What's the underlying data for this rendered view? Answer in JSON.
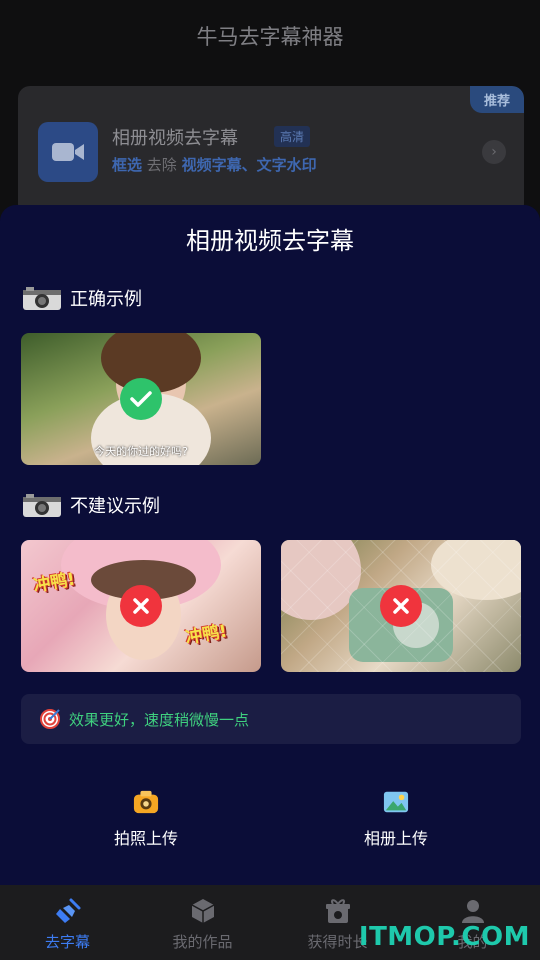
{
  "app": {
    "title": "牛马去字幕神器"
  },
  "feature_card": {
    "badge": "推荐",
    "title": "相册视频去字幕",
    "hd_tag": "高清",
    "sub_select": "框选",
    "sub_remove": " 去除 ",
    "sub_targets": "视频字幕、文字水印"
  },
  "sheet": {
    "title": "相册视频去字幕",
    "correct_label": "正确示例",
    "incorrect_label": "不建议示例",
    "correct_example": {
      "subtitle": "今天的你过的好吗?"
    },
    "bad_example_1": {
      "sticker_left": "冲鸭!",
      "sticker_right": "冲鸭!"
    },
    "tip": "效果更好，速度稍微慢一点",
    "upload_camera": "拍照上传",
    "upload_album": "相册上传"
  },
  "tabs": [
    {
      "label": "去字幕",
      "icon": "broom-icon",
      "active": true
    },
    {
      "label": "我的作品",
      "icon": "box-icon",
      "active": false
    },
    {
      "label": "获得时长",
      "icon": "gift-icon",
      "active": false
    },
    {
      "label": "我的",
      "icon": "user-icon",
      "active": false
    }
  ],
  "watermark": "ITMOP.COM",
  "colors": {
    "sheet_bg": "#0b0d38",
    "accent_blue": "#3d7cf2",
    "success_green": "#2ec36b",
    "error_red": "#f0343d",
    "tip_green": "#3fd07f"
  }
}
